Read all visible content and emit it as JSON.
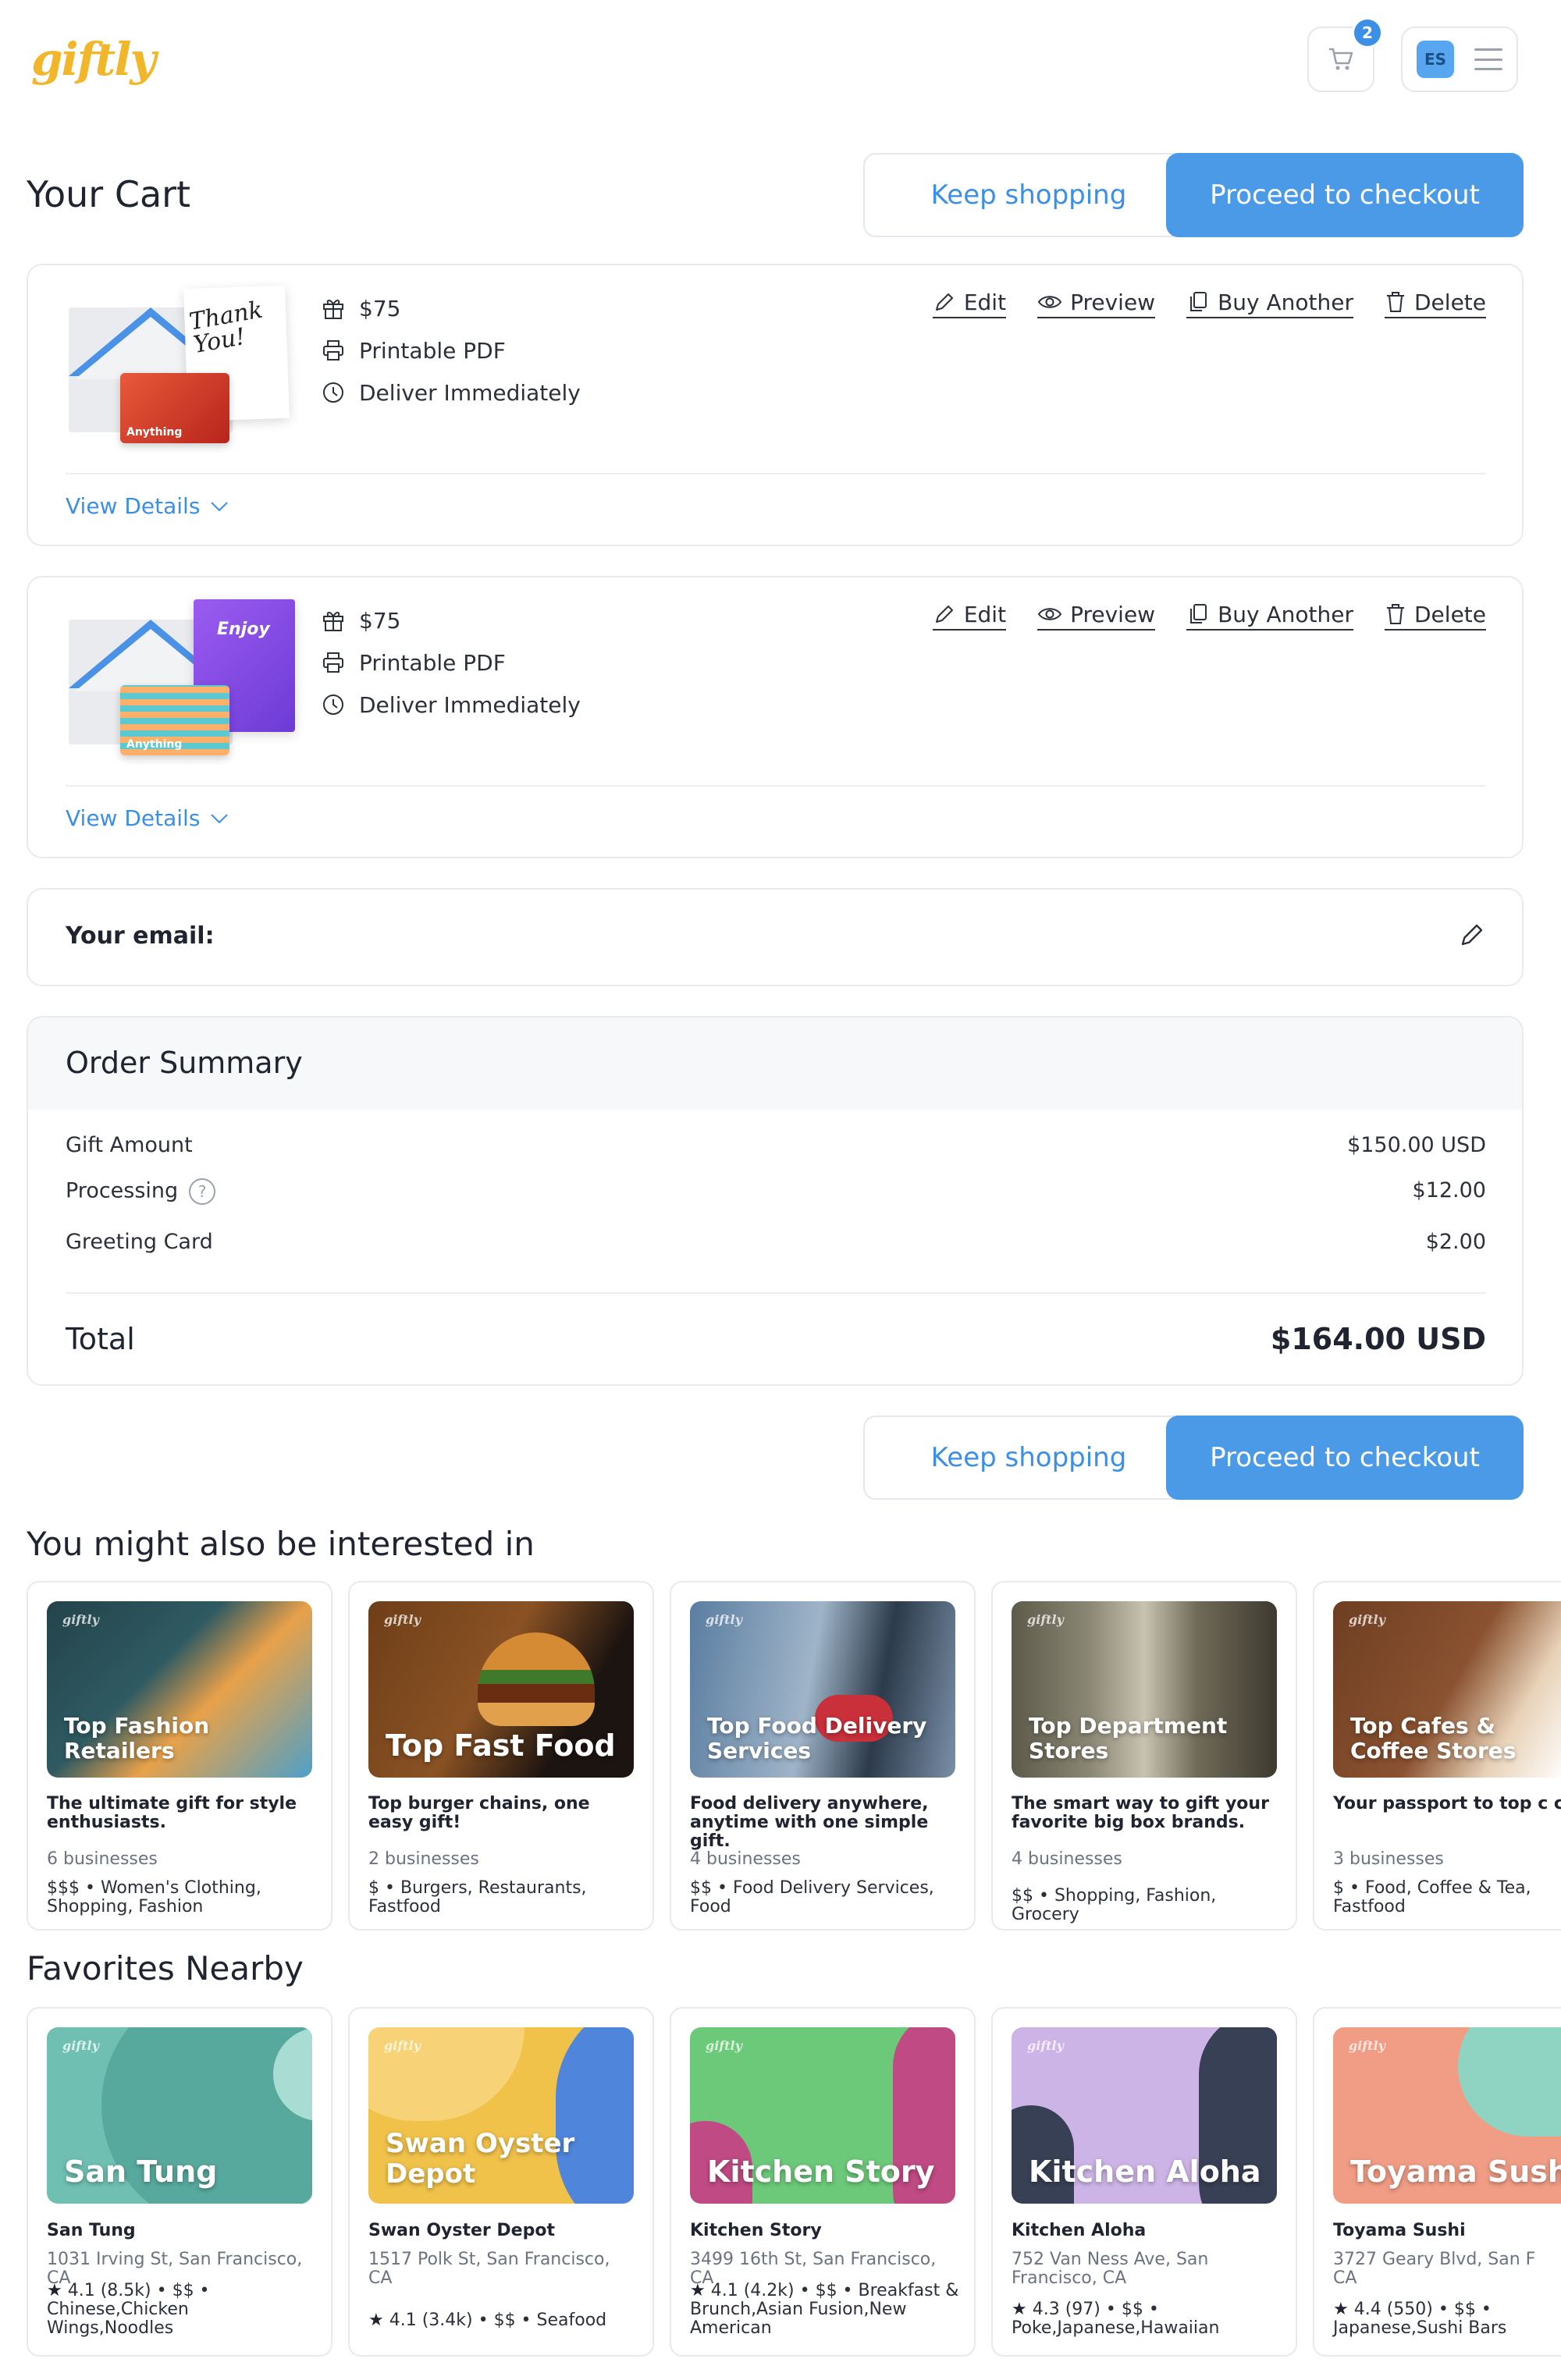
{
  "header": {
    "logo": "giftly",
    "cart_count": "2",
    "user_initials": "ES"
  },
  "cart": {
    "title": "Your Cart",
    "keep_shopping": "Keep shopping",
    "proceed": "Proceed to checkout",
    "items": [
      {
        "amount": "$75",
        "format": "Printable PDF",
        "delivery": "Deliver Immediately",
        "card_text": "Thank You!",
        "giftcard_label": "Anything",
        "actions": {
          "edit": "Edit",
          "preview": "Preview",
          "buy_another": "Buy Another",
          "delete": "Delete"
        },
        "view_details": "View Details"
      },
      {
        "amount": "$75",
        "format": "Printable PDF",
        "delivery": "Deliver Immediately",
        "card_text": "Enjoy",
        "giftcard_label": "Anything",
        "actions": {
          "edit": "Edit",
          "preview": "Preview",
          "buy_another": "Buy Another",
          "delete": "Delete"
        },
        "view_details": "View Details"
      }
    ]
  },
  "email": {
    "label": "Your email:"
  },
  "summary": {
    "title": "Order Summary",
    "gift_amount_label": "Gift Amount",
    "gift_amount_value": "$150.00 USD",
    "processing_label": "Processing",
    "processing_value": "$12.00",
    "greeting_label": "Greeting Card",
    "greeting_value": "$2.00",
    "total_label": "Total",
    "total_value": "$164.00 USD"
  },
  "interested": {
    "title": "You might also be interested in",
    "tiles": [
      {
        "img_title": "Top Fashion Retailers",
        "desc": "The ultimate gift for style enthusiasts.",
        "count": "6 businesses",
        "tags": "$$$ • Women's Clothing, Shopping, Fashion",
        "color": "#2f4b52"
      },
      {
        "img_title": "Top Fast Food",
        "desc": "Top burger chains, one easy gift!",
        "count": "2 businesses",
        "tags": "$ • Burgers, Restaurants, Fastfood",
        "color": "#7a4a22"
      },
      {
        "img_title": "Top Food Delivery Services",
        "desc": "Food delivery anywhere, anytime with one simple gift.",
        "count": "4 businesses",
        "tags": "$$ • Food Delivery Services, Food",
        "color": "#4f6f8c"
      },
      {
        "img_title": "Top Department Stores",
        "desc": "The smart way to gift your favorite big box brands.",
        "count": "4 businesses",
        "tags": "$$ • Shopping, Fashion, Grocery",
        "color": "#6e6a5a"
      },
      {
        "img_title": "Top Cafes & Coffee Stores",
        "desc": "Your passport to top c chains nationwide.",
        "count": "3 businesses",
        "tags": "$ • Food, Coffee & Tea, Fastfood",
        "color": "#7a4a2a"
      }
    ]
  },
  "nearby": {
    "title": "Favorites Nearby",
    "tiles": [
      {
        "img_title": "San Tung",
        "name": "San Tung",
        "address": "1031 Irving St, San Francisco, CA",
        "rating": "4.1 (8.5k) • $$ • Chinese,Chicken Wings,Noodles",
        "color": "#7cc7bb"
      },
      {
        "img_title": "Swan Oyster Depot",
        "name": "Swan Oyster Depot",
        "address": "1517 Polk St, San Francisco, CA",
        "rating": "4.1 (3.4k) • $$ • Seafood",
        "color": "#f1c24a"
      },
      {
        "img_title": "Kitchen Story",
        "name": "Kitchen Story",
        "address": "3499 16th St, San Francisco, CA",
        "rating": "4.1 (4.2k) • $$ • Breakfast & Brunch,Asian Fusion,New American",
        "color": "#6cc979"
      },
      {
        "img_title": "Kitchen Aloha",
        "name": "Kitchen Aloha",
        "address": "752 Van Ness Ave, San Francisco, CA",
        "rating": "4.3 (97) • $$ • Poke,Japanese,Hawaiian",
        "color": "#cdb4e6"
      },
      {
        "img_title": "Toyama Sushi",
        "name": "Toyama Sushi",
        "address": "3727 Geary Blvd, San F CA",
        "rating": "4.4 (550) • $$ • Japanese,Sushi Bars",
        "color": "#f19d85"
      }
    ]
  },
  "colors": {
    "accent": "#4a9ae8",
    "logo": "#f2b62b",
    "text": "#1f2430"
  }
}
